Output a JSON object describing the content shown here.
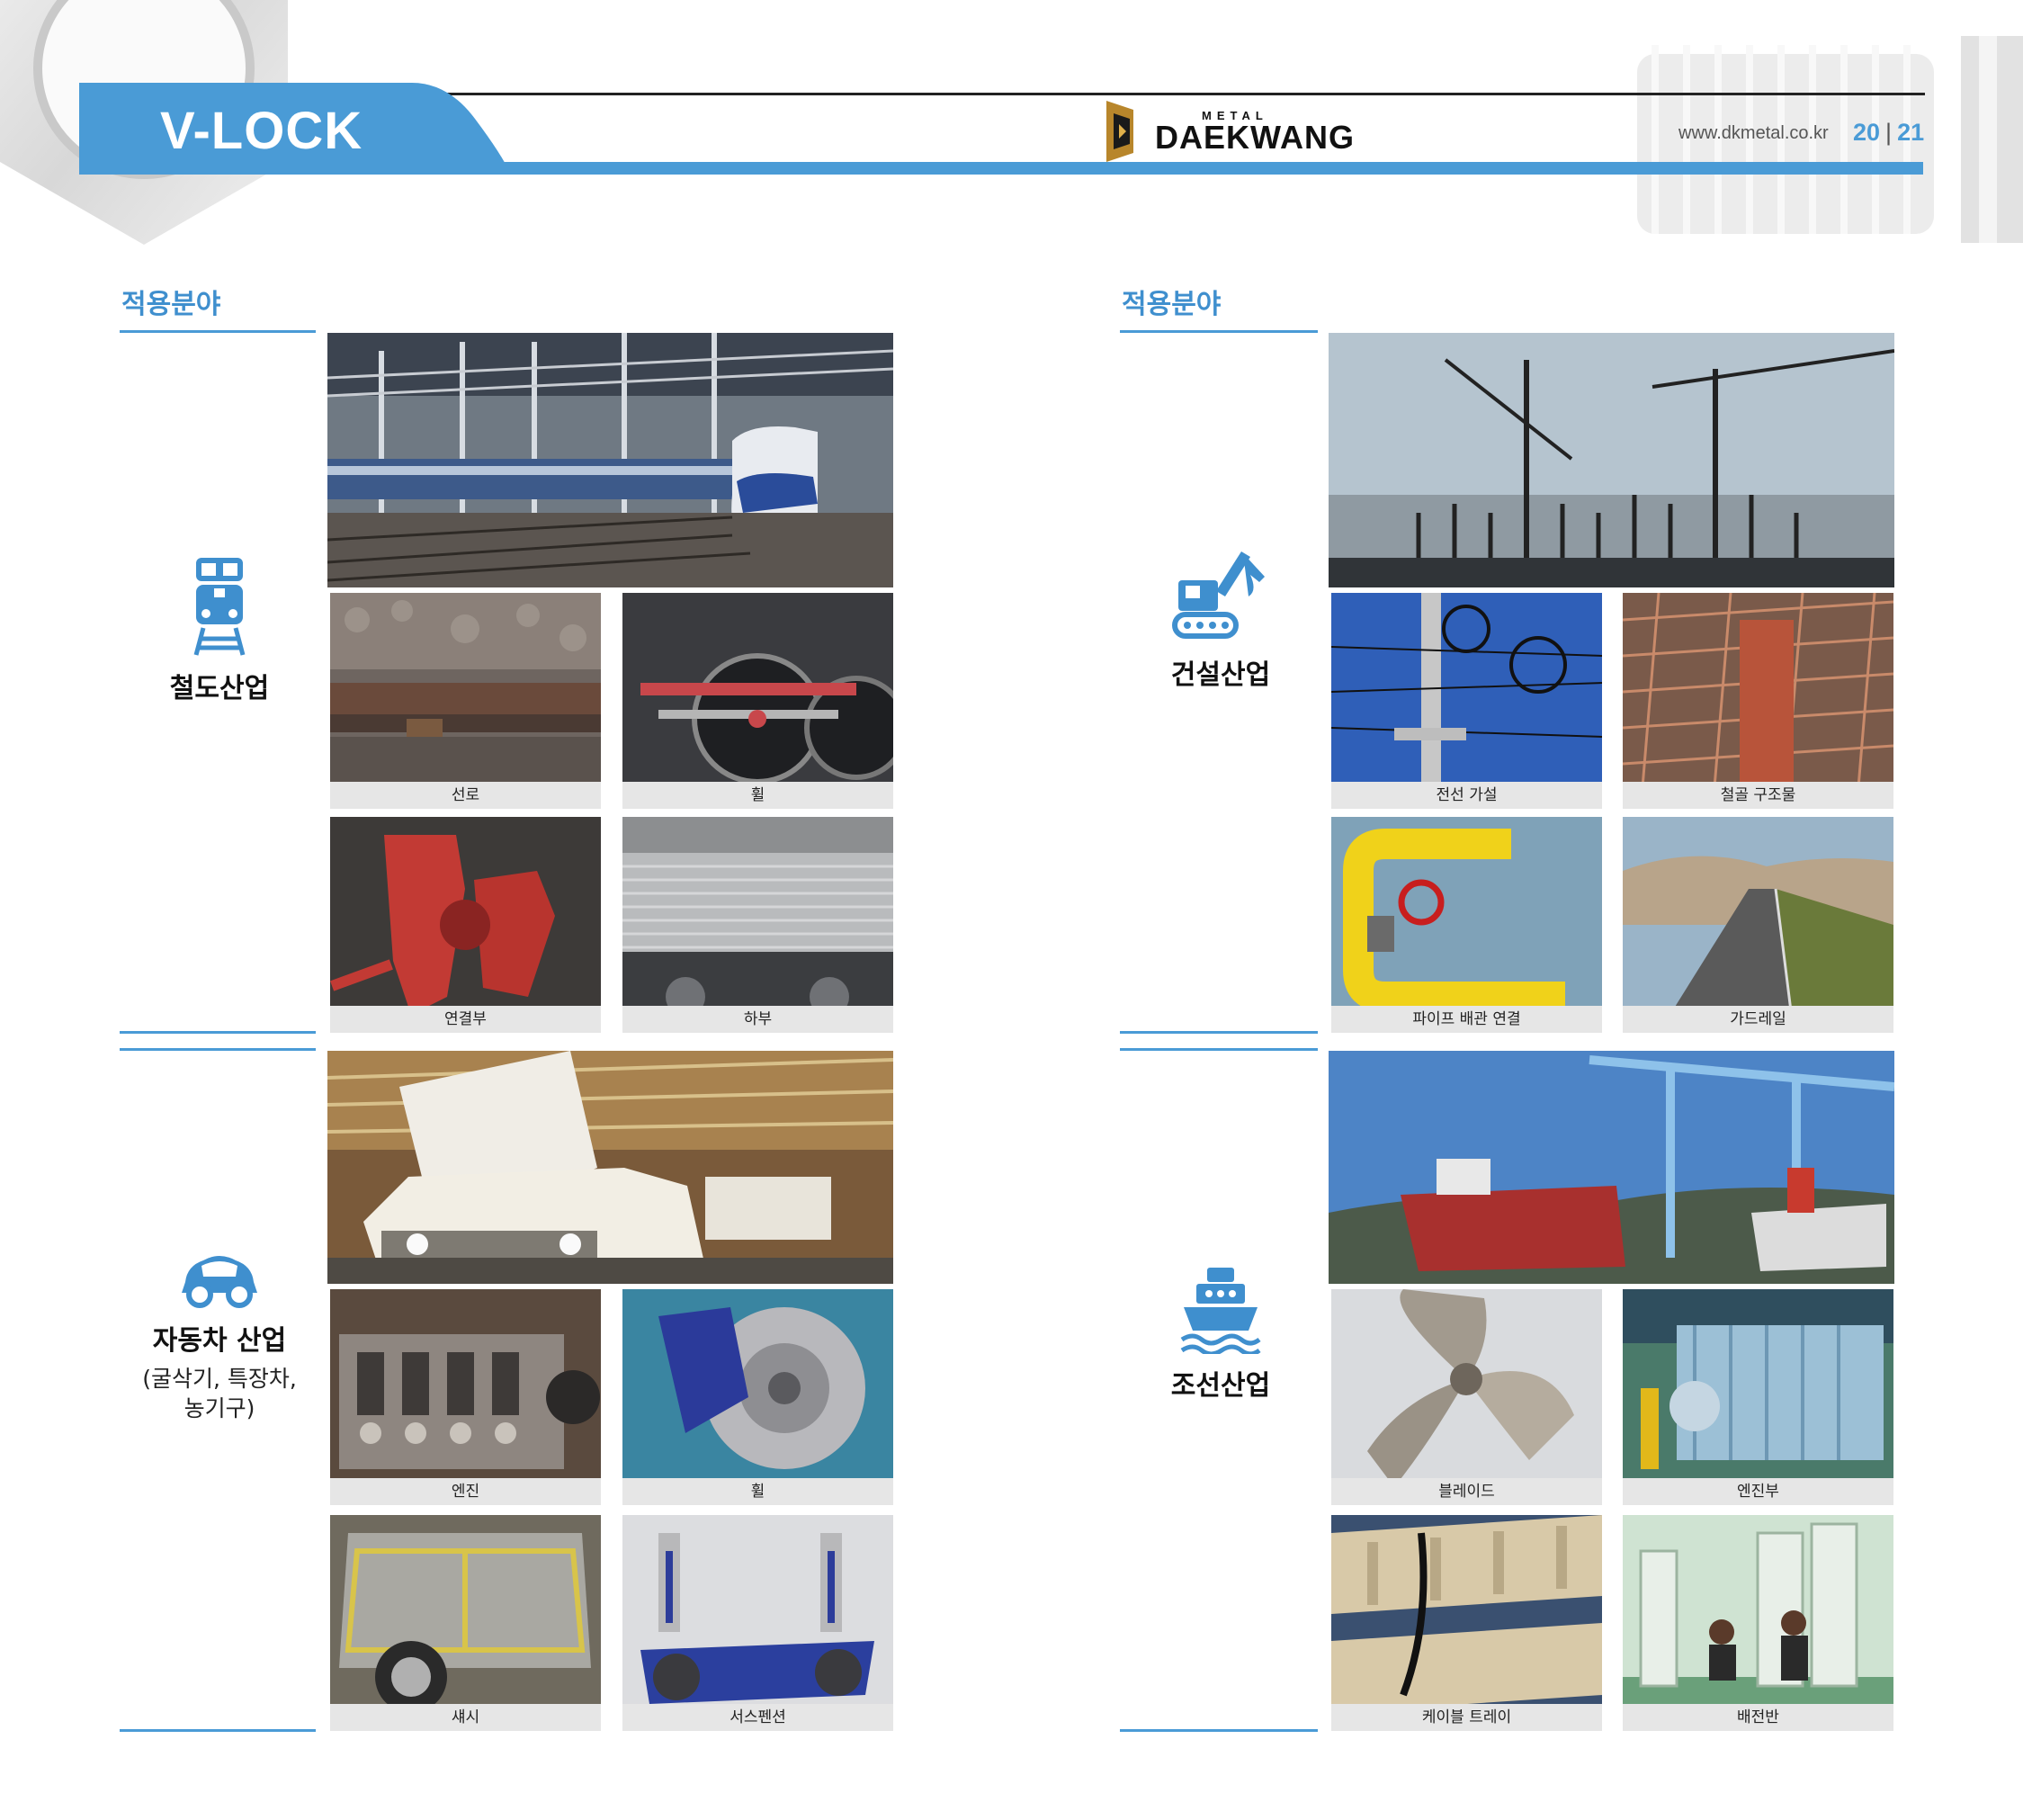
{
  "header": {
    "title": "V-LOCK",
    "logo_small": "METAL",
    "logo_big": "DAEKWANG",
    "url": "www.dkmetal.co.kr",
    "page_left": "20",
    "page_sep": "|",
    "page_right": "21"
  },
  "left": {
    "section_title": "적용분야",
    "railway": {
      "name": "철도산업",
      "captions": [
        "선로",
        "휠",
        "연결부",
        "하부"
      ]
    },
    "automotive": {
      "name": "자동차 산업",
      "sub_line1": "(굴삭기, 특장차,",
      "sub_line2": "농기구)",
      "captions": [
        "엔진",
        "휠",
        "섀시",
        "서스펜션"
      ]
    }
  },
  "right": {
    "section_title": "적용분야",
    "construction": {
      "name": "건설산업",
      "captions": [
        "전선 가설",
        "철골 구조물",
        "파이프 배관 연결",
        "가드레일"
      ]
    },
    "shipbuilding": {
      "name": "조선산업",
      "captions": [
        "블레이드",
        "엔진부",
        "케이블 트레이",
        "배전반"
      ]
    }
  },
  "colors": {
    "accent": "#4a9bd6",
    "title_blue": "#3f8fce",
    "caption_bg": "#e6e6e6"
  }
}
